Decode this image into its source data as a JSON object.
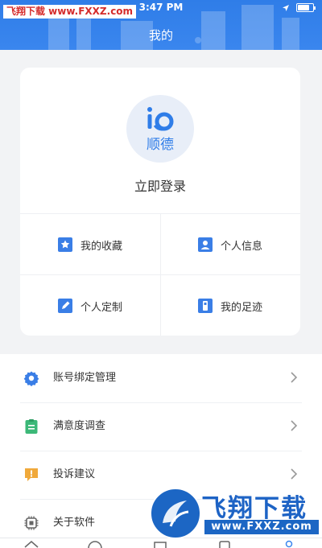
{
  "watermark_top": "飞翔下载 www.FXXZ.com",
  "status_bar": {
    "time": "3:47 PM"
  },
  "header": {
    "title": "我的"
  },
  "profile": {
    "logo_text": "顺德",
    "login_label": "立即登录"
  },
  "grid": [
    {
      "label": "我的收藏",
      "icon": "star-icon"
    },
    {
      "label": "个人信息",
      "icon": "person-card-icon"
    },
    {
      "label": "个人定制",
      "icon": "edit-icon"
    },
    {
      "label": "我的足迹",
      "icon": "footprint-icon"
    }
  ],
  "menu": [
    {
      "label": "账号绑定管理",
      "icon": "gear-icon"
    },
    {
      "label": "满意度调查",
      "icon": "clipboard-icon"
    },
    {
      "label": "投诉建议",
      "icon": "alert-icon"
    },
    {
      "label": "关于软件",
      "icon": "chip-icon"
    }
  ],
  "watermark_bottom": {
    "main": "飞翔下载",
    "url": "www.FXXZ.com"
  },
  "colors": {
    "primary": "#3a86ee",
    "accent_green": "#3cb878",
    "accent_orange": "#f0a93b"
  }
}
